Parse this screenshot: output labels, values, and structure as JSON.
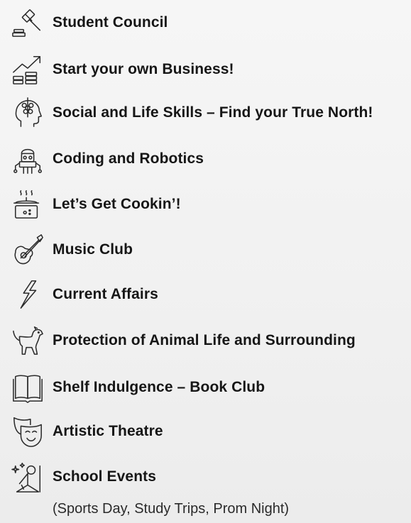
{
  "activities": [
    {
      "icon": "gavel-icon",
      "label": "Student Council"
    },
    {
      "icon": "growth-chart-icon",
      "label": "Start your own Business!"
    },
    {
      "icon": "head-mind-icon",
      "label": "Social and Life Skills – Find your True North!"
    },
    {
      "icon": "robot-icon",
      "label": "Coding and Robotics"
    },
    {
      "icon": "cooking-pot-icon",
      "label": "Let’s Get Cookin’!"
    },
    {
      "icon": "guitar-icon",
      "label": "Music Club"
    },
    {
      "icon": "lightning-icon",
      "label": "Current Affairs"
    },
    {
      "icon": "dog-icon",
      "label": "Protection of Animal Life and Surrounding"
    },
    {
      "icon": "open-book-icon",
      "label": "Shelf Indulgence – Book Club"
    },
    {
      "icon": "theatre-mask-icon",
      "label": "Artistic Theatre"
    },
    {
      "icon": "microphone-sparkle-icon",
      "label": "School Events"
    }
  ],
  "school_events_note": "(Sports Day, Study Trips, Prom Night)"
}
